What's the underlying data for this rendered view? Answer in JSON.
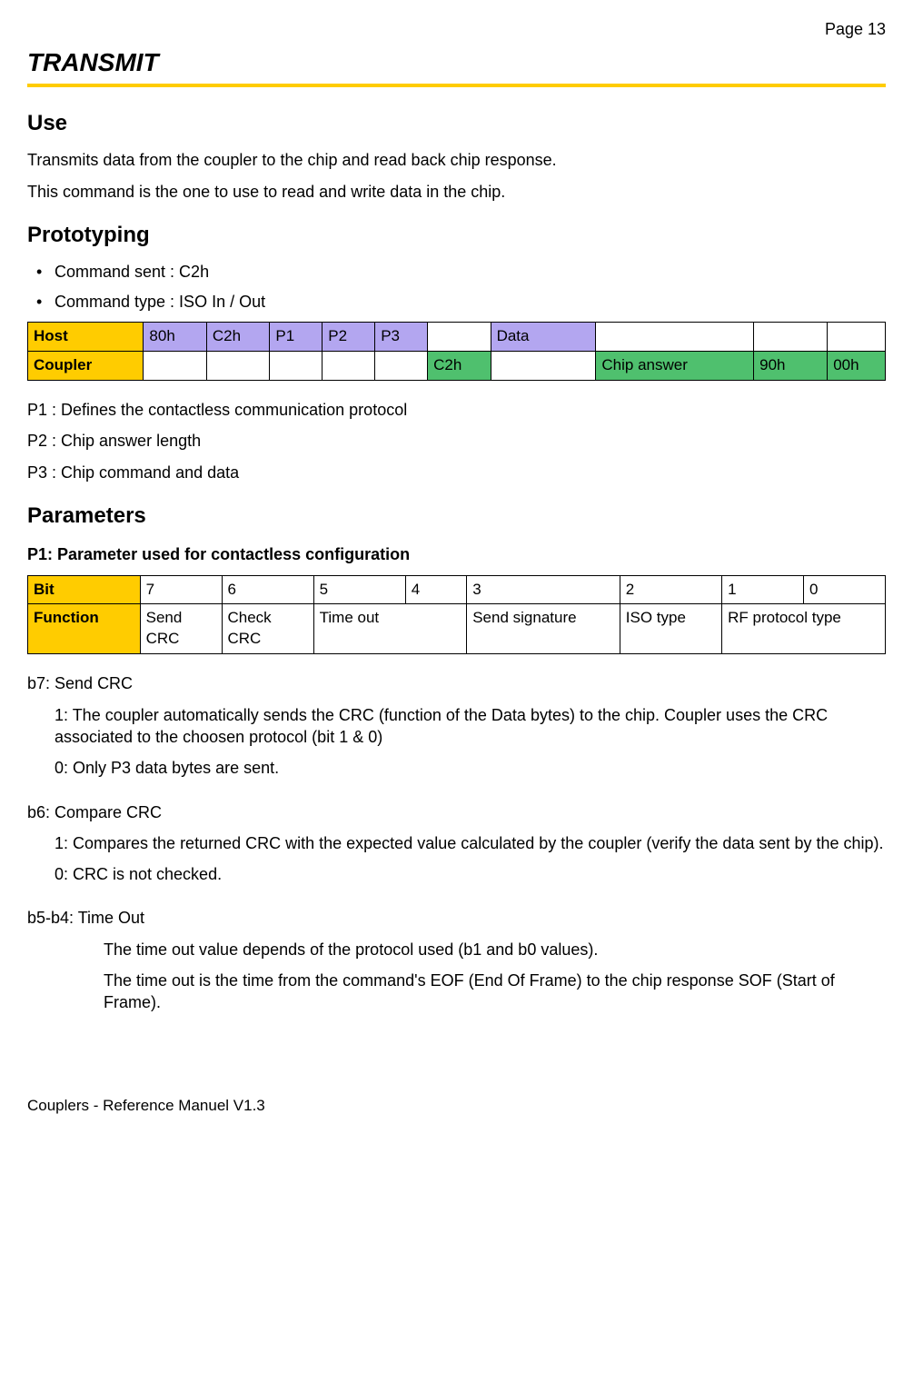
{
  "pageNum": "Page 13",
  "title": "TRANSMIT",
  "sections": {
    "use": {
      "heading": "Use",
      "p1": "Transmits data from the coupler to the chip and read back chip response.",
      "p2": "This command is the one to use to read and write data in the chip."
    },
    "prototyping": {
      "heading": "Prototyping",
      "bullets": [
        "Command sent : C2h",
        "Command type : ISO In / Out"
      ]
    },
    "protoTable": {
      "hostLabel": "Host",
      "couplerLabel": "Coupler",
      "hostRow": [
        "80h",
        "C2h",
        "P1",
        "P2",
        "P3",
        "",
        "Data",
        "",
        "",
        ""
      ],
      "couplerRow": [
        "",
        "",
        "",
        "",
        "",
        "C2h",
        "",
        "Chip answer",
        "90h",
        "00h"
      ]
    },
    "pdesc": {
      "p1": "P1 : Defines the contactless communication protocol",
      "p2": "P2 : Chip answer length",
      "p3": "P3 : Chip command and data"
    },
    "parameters": {
      "heading": "Parameters",
      "sub": "P1: Parameter used for contactless configuration"
    },
    "bitTable": {
      "bitLabel": "Bit",
      "funcLabel": "Function",
      "bits": [
        "7",
        "6",
        "5",
        "4",
        "3",
        "2",
        "1",
        "0"
      ],
      "funcs": [
        "Send CRC",
        "Check CRC",
        "Time out",
        "Send signature",
        "ISO type",
        "RF protocol type"
      ]
    },
    "b7": {
      "title": "b7: Send CRC",
      "o1": "1: The coupler automatically sends the CRC (function of the Data bytes) to the chip. Coupler uses the CRC associated to the choosen protocol (bit 1 & 0)",
      "o0": "0: Only P3 data bytes are sent."
    },
    "b6": {
      "title": "b6: Compare CRC",
      "o1": "1: Compares the returned CRC with the expected value calculated by the coupler (verify the data sent by the chip).",
      "o0": "0: CRC is not checked."
    },
    "b54": {
      "title": "b5-b4: Time Out",
      "l1": "The time out value depends of the protocol used (b1 and b0 values).",
      "l2": "The time out is the time from the command's EOF (End Of Frame) to the chip response SOF (Start of Frame)."
    }
  },
  "footer": "Couplers - Reference Manuel V1.3"
}
